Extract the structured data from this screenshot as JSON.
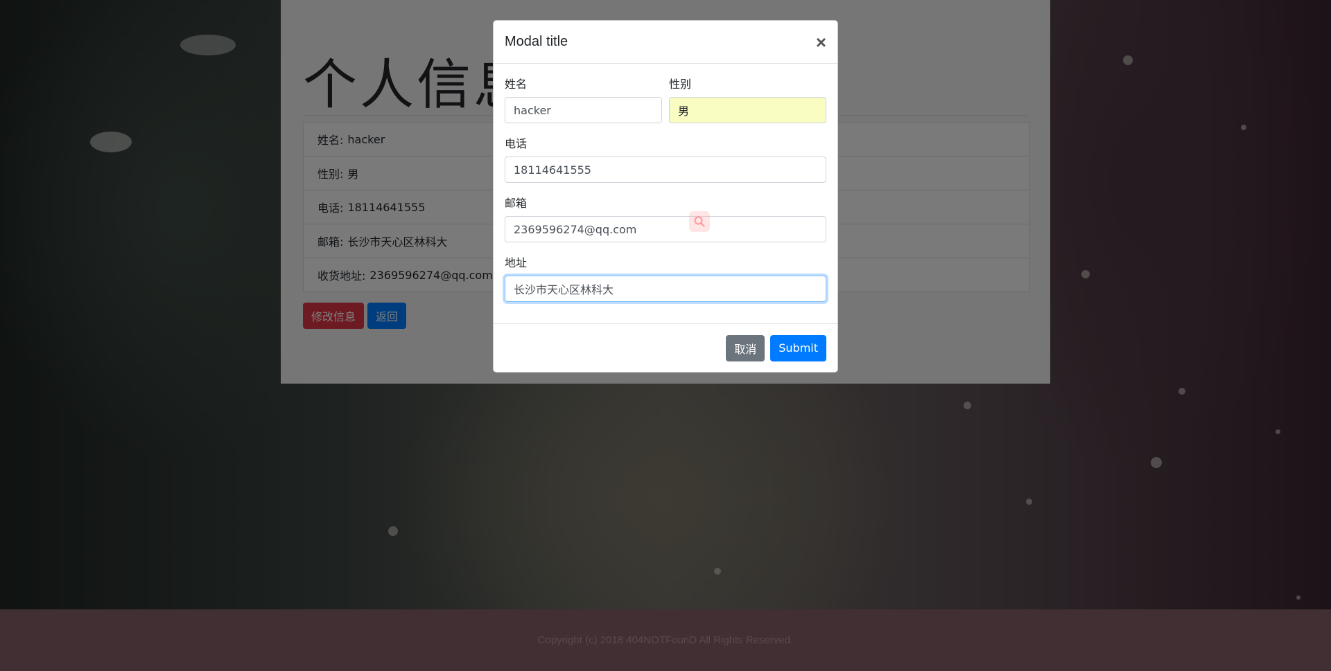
{
  "page": {
    "title": "个人信息",
    "info_rows": [
      {
        "label": "姓名:",
        "value": "hacker"
      },
      {
        "label": "性别:",
        "value": "男"
      },
      {
        "label": "电话:",
        "value": "18114641555"
      },
      {
        "label": "邮箱:",
        "value": "长沙市天心区林科大"
      },
      {
        "label": "收货地址:",
        "value": "2369596274@qq.com"
      }
    ],
    "edit_button": "修改信息",
    "back_button": "返回"
  },
  "modal": {
    "title": "Modal title",
    "close_symbol": "×",
    "fields": {
      "name": {
        "label": "姓名",
        "value": "hacker"
      },
      "gender": {
        "label": "性别",
        "value": "男"
      },
      "phone": {
        "label": "电话",
        "value": "18114641555"
      },
      "email": {
        "label": "邮箱",
        "value": "2369596274@qq.com"
      },
      "address": {
        "label": "地址",
        "value": "长沙市天心区林科大"
      }
    },
    "cancel_button": "取消",
    "submit_button": "Submit"
  },
  "footer": {
    "copyright": "Copyright (c) 2018 404NOTFounD All Rights Reserved."
  },
  "colors": {
    "danger": "#dc3545",
    "primary": "#007bff",
    "secondary": "#6c757d",
    "footer_bg": "#835f69"
  }
}
